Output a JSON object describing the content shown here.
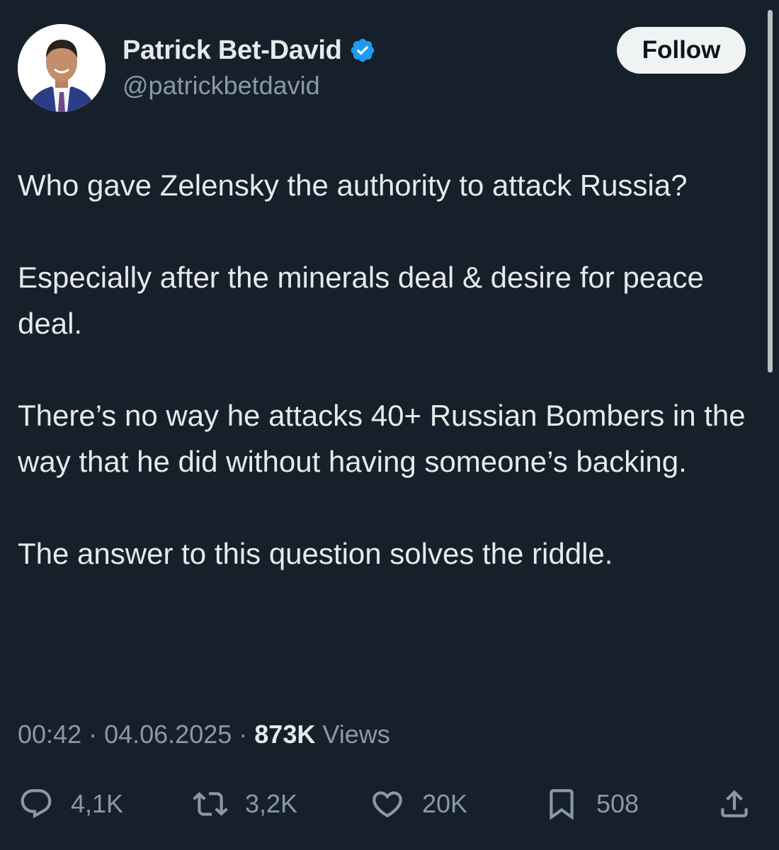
{
  "author": {
    "display_name": "Patrick Bet-David",
    "handle": "@patrickbetdavid",
    "verified": true
  },
  "follow_button": {
    "label": "Follow"
  },
  "tweet": {
    "paragraphs": [
      "Who gave Zelensky the authority to attack Russia?",
      "Especially after the minerals deal & desire for peace deal.",
      "There’s no way he attacks 40+ Russian Bombers in the way that he did without having someone’s backing.",
      "The answer to this question solves the riddle."
    ]
  },
  "meta": {
    "time": "00:42",
    "separator": " · ",
    "date": "04.06.2025",
    "views_count": "873K",
    "views_label": " Views"
  },
  "actions": {
    "reply": {
      "icon": "reply-icon",
      "count": "4,1K"
    },
    "retweet": {
      "icon": "retweet-icon",
      "count": "3,2K"
    },
    "like": {
      "icon": "heart-icon",
      "count": "20K"
    },
    "bookmark": {
      "icon": "bookmark-icon",
      "count": "508"
    },
    "share": {
      "icon": "share-icon"
    }
  },
  "colors": {
    "background": "#15202b",
    "primary_text": "#e7e9ea",
    "secondary_text": "#8b98a5",
    "verified_blue": "#1d9bf0",
    "follow_button_bg": "#eff3f4"
  }
}
